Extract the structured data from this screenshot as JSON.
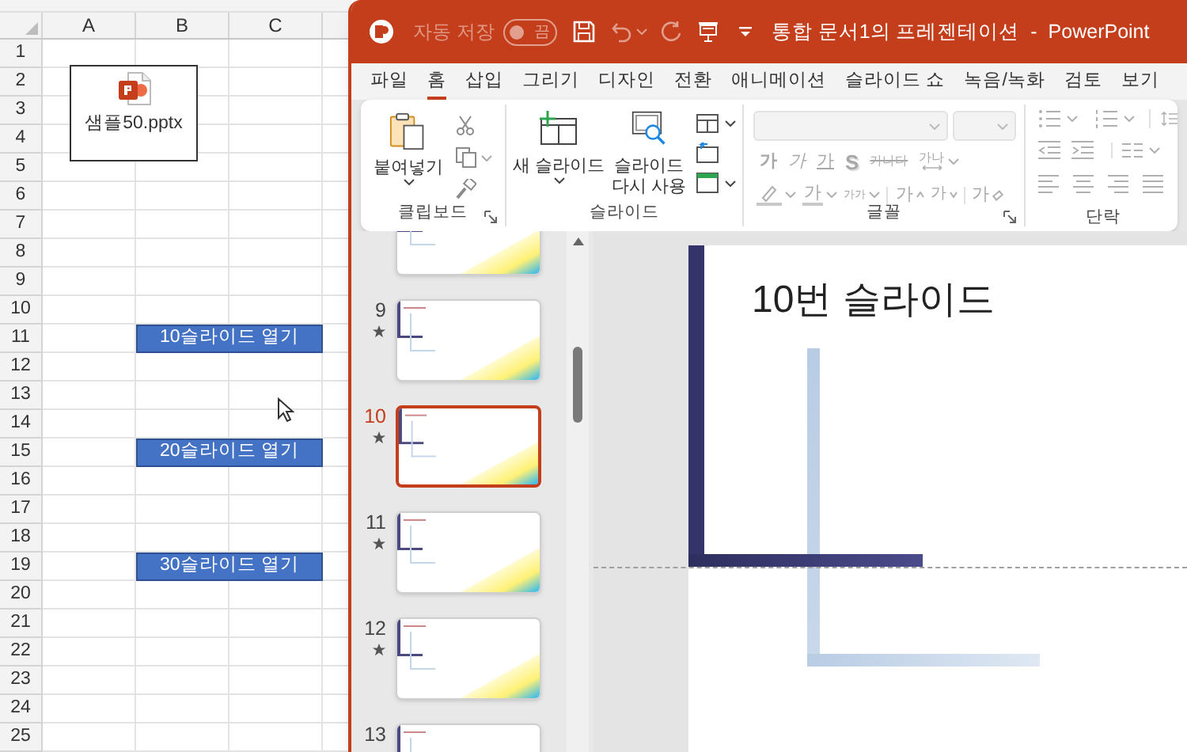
{
  "spreadsheet": {
    "columns": [
      "A",
      "B",
      "C"
    ],
    "rows": [
      {
        "label": "1"
      },
      {
        "label": "2",
        "object": {
          "file_name": "샘플50.pptx"
        }
      },
      {
        "label": "3"
      },
      {
        "label": "4"
      },
      {
        "label": "5"
      },
      {
        "label": "6"
      },
      {
        "label": "7"
      },
      {
        "label": "8"
      },
      {
        "label": "9"
      },
      {
        "label": "10"
      },
      {
        "label": "11",
        "button": "10슬라이드 열기"
      },
      {
        "label": "12"
      },
      {
        "label": "13"
      },
      {
        "label": "14"
      },
      {
        "label": "15",
        "button": "20슬라이드 열기"
      },
      {
        "label": "16"
      },
      {
        "label": "17"
      },
      {
        "label": "18"
      },
      {
        "label": "19",
        "button": "30슬라이드 열기"
      },
      {
        "label": "20"
      },
      {
        "label": "21"
      },
      {
        "label": "22"
      },
      {
        "label": "23"
      },
      {
        "label": "24"
      },
      {
        "label": "25"
      }
    ]
  },
  "powerpoint": {
    "title_bar": {
      "autosave_label": "자동 저장",
      "autosave": {
        "on": false,
        "label": "끔"
      },
      "title": "통합 문서1의 프레젠테이션  -  PowerPoint"
    },
    "tabs": [
      {
        "label": "파일",
        "selected": false
      },
      {
        "label": "홈",
        "selected": true
      },
      {
        "label": "삽입",
        "selected": false
      },
      {
        "label": "그리기",
        "selected": false
      },
      {
        "label": "디자인",
        "selected": false
      },
      {
        "label": "전환",
        "selected": false
      },
      {
        "label": "애니메이션",
        "selected": false
      },
      {
        "label": "슬라이드 쇼",
        "selected": false
      },
      {
        "label": "녹음/녹화",
        "selected": false
      },
      {
        "label": "검토",
        "selected": false
      },
      {
        "label": "보기",
        "selected": false
      }
    ],
    "ribbon": {
      "groups": [
        {
          "kind": "clipboard",
          "label": "클립보드",
          "paste": "붙여넣기"
        },
        {
          "kind": "slides",
          "label": "슬라이드",
          "new_slide": "새 슬라이드",
          "reuse": [
            "슬라이드",
            "다시 사용"
          ]
        },
        {
          "kind": "font",
          "label": "글꼴",
          "disabled": true,
          "row_1": [
            {
              "kind": "bold",
              "text": "가"
            },
            {
              "kind": "italic",
              "text": "가"
            },
            {
              "kind": "underline",
              "text": "가"
            },
            {
              "kind": "shadow",
              "text": "S"
            },
            {
              "kind": "strike",
              "text": "가나다"
            },
            {
              "kind": "spacing",
              "text": "가나"
            }
          ],
          "row_2": [
            {
              "kind": "highlight"
            },
            {
              "kind": "color",
              "text": "가"
            },
            {
              "kind": "case",
              "text": "가가"
            },
            {
              "kind": "grow",
              "text": "가"
            },
            {
              "kind": "shrink",
              "text": "가"
            },
            {
              "kind": "clear",
              "text": "가"
            }
          ]
        },
        {
          "kind": "paragraph",
          "label": "단락",
          "disabled": true
        }
      ]
    },
    "thumbnails": [
      {
        "selected": false
      },
      {
        "number": "9",
        "animated": true,
        "selected": false
      },
      {
        "number": "10",
        "animated": true,
        "selected": true
      },
      {
        "number": "11",
        "animated": true,
        "selected": false
      },
      {
        "number": "12",
        "animated": true,
        "selected": false
      },
      {
        "number": "13",
        "selected": false
      }
    ],
    "slide": {
      "title": "10번 슬라이드"
    }
  }
}
